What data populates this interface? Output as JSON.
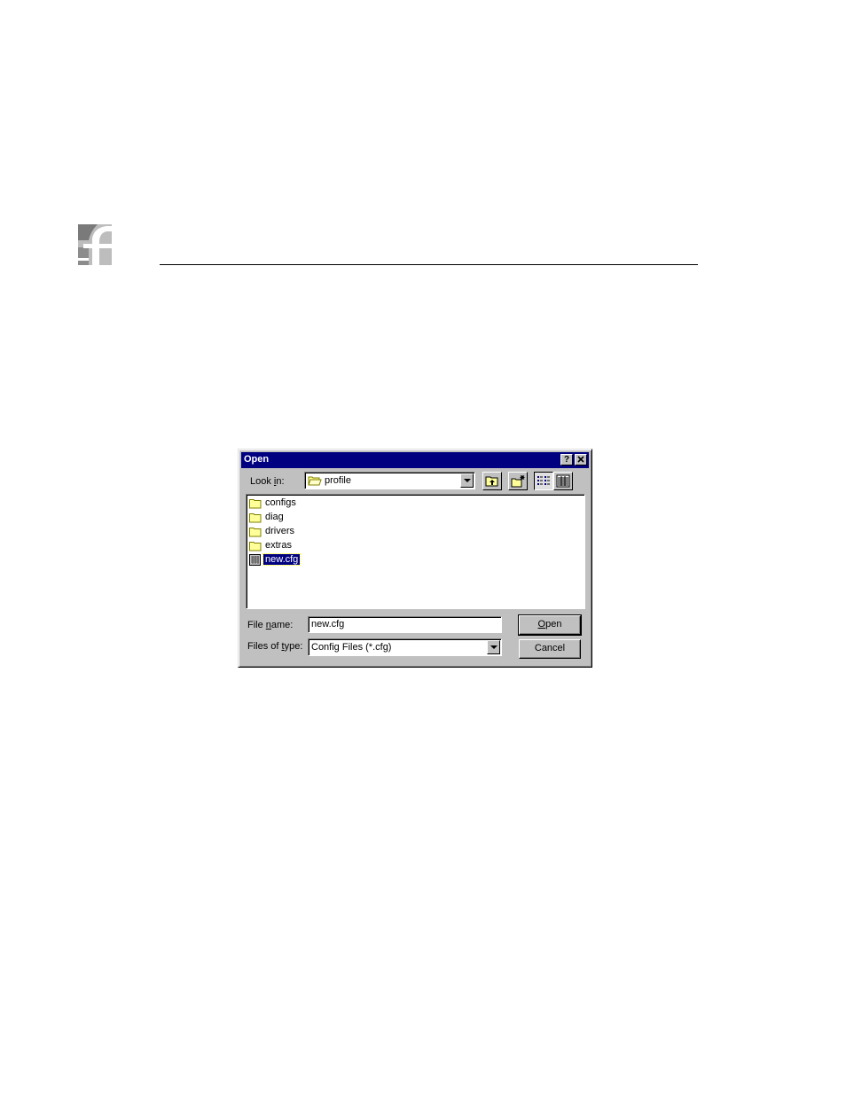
{
  "dialog": {
    "title": "Open",
    "help_button": "?",
    "close_button": "✕",
    "look_in": {
      "label_pre": "Look ",
      "label_key": "i",
      "label_post": "n:",
      "value": "profile"
    },
    "files": [
      {
        "name": "configs",
        "type": "folder"
      },
      {
        "name": "diag",
        "type": "folder"
      },
      {
        "name": "drivers",
        "type": "folder"
      },
      {
        "name": "extras",
        "type": "folder"
      },
      {
        "name": "new.cfg",
        "type": "file",
        "selected": true
      }
    ],
    "file_name": {
      "label_pre": "File ",
      "label_key": "n",
      "label_post": "ame:",
      "value": "new.cfg"
    },
    "files_of_type": {
      "label_pre": "Files of ",
      "label_key": "t",
      "label_post": "ype:",
      "value": "Config Files (*.cfg)"
    },
    "open_button": {
      "key": "O",
      "rest": "pen"
    },
    "cancel_button": "Cancel"
  },
  "colors": {
    "titlebar": "#000080",
    "face": "#c0c0c0",
    "selection": "#000080",
    "folder": "#ffff99"
  }
}
